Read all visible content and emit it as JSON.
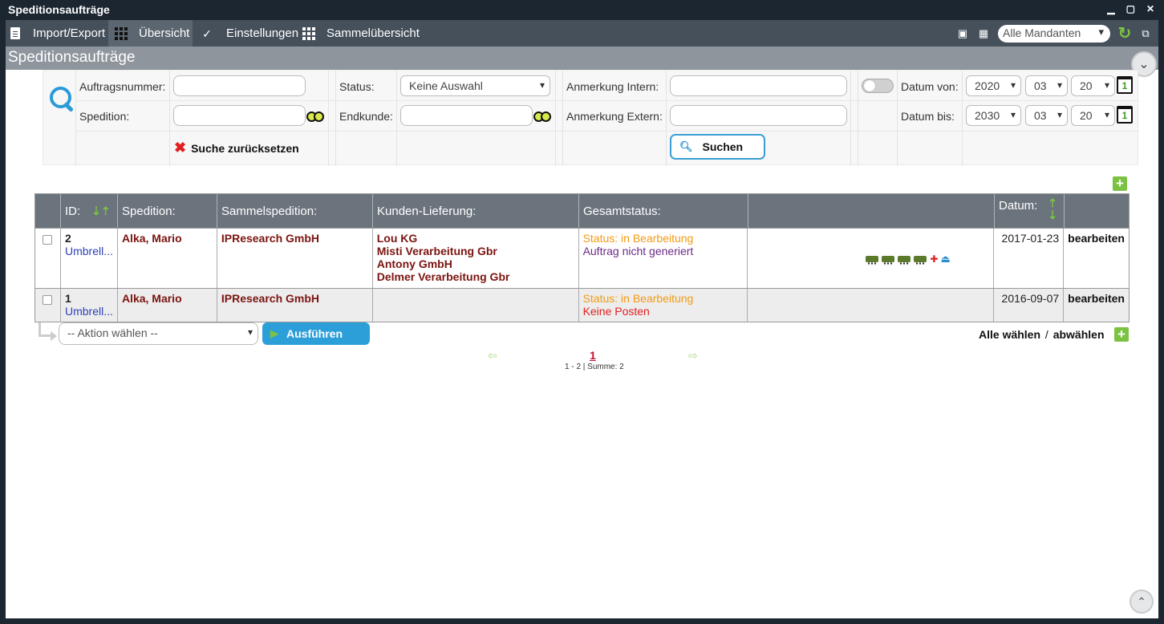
{
  "window": {
    "title": "Speditionsaufträge",
    "min": "▁",
    "max": "▢",
    "close": "✕"
  },
  "toolbar": {
    "items": [
      {
        "label": "Import/Export"
      },
      {
        "label": "Übersicht"
      },
      {
        "label": "Einstellungen"
      },
      {
        "label": "Sammelübersicht"
      }
    ],
    "mandant": "Alle Mandanten"
  },
  "section": {
    "title": "Speditionsaufträge"
  },
  "search": {
    "auftragsnummer_label": "Auftragsnummer:",
    "spedition_label": "Spedition:",
    "status_label": "Status:",
    "status_value": "Keine Auswahl",
    "endkunde_label": "Endkunde:",
    "anmerkung_intern_label": "Anmerkung Intern:",
    "anmerkung_extern_label": "Anmerkung Extern:",
    "datum_von_label": "Datum von:",
    "datum_bis_label": "Datum bis:",
    "von": {
      "year": "2020",
      "month": "03",
      "day": "20"
    },
    "bis": {
      "year": "2030",
      "month": "03",
      "day": "20"
    },
    "calendar_day": "1",
    "reset_label": "Suche zurücksetzen",
    "search_button": "Suchen"
  },
  "table": {
    "headers": {
      "id": "ID:",
      "spedition": "Spedition:",
      "sammelspedition": "Sammelspedition:",
      "kunden": "Kunden-Lieferung:",
      "gesamtstatus": "Gesamtstatus:",
      "datum": "Datum:"
    },
    "rows": [
      {
        "id": "2",
        "sub": "Umbrell...",
        "spedition": "Alka, Mario",
        "sammelspedition": "IPResearch GmbH",
        "kunden": [
          "Lou KG",
          "Misti Verarbeitung Gbr",
          "Antony GmbH",
          "Delmer Verarbeitung Gbr"
        ],
        "status": "Status: in Bearbeitung",
        "status2": "Auftrag nicht generiert",
        "datum": "2017-01-23",
        "action": "bearbeiten"
      },
      {
        "id": "1",
        "sub": "Umbrell...",
        "spedition": "Alka, Mario",
        "sammelspedition": "IPResearch GmbH",
        "kunden": [],
        "status": "Status: in Bearbeitung",
        "status2": "Keine Posten",
        "datum": "2016-09-07",
        "action": "bearbeiten"
      }
    ]
  },
  "footer": {
    "aktion_placeholder": "-- Aktion wählen --",
    "ausfuehren": "Ausführen",
    "alle_waehlen": "Alle wählen",
    "separator": "/",
    "abwaehlen": "abwählen",
    "page": "1",
    "summary": "1 - 2 | Summe: 2"
  },
  "colors": {
    "accent": "#2c9fd9",
    "green": "#7cc242",
    "toolbar": "#46505b",
    "header": "#6b747d"
  }
}
